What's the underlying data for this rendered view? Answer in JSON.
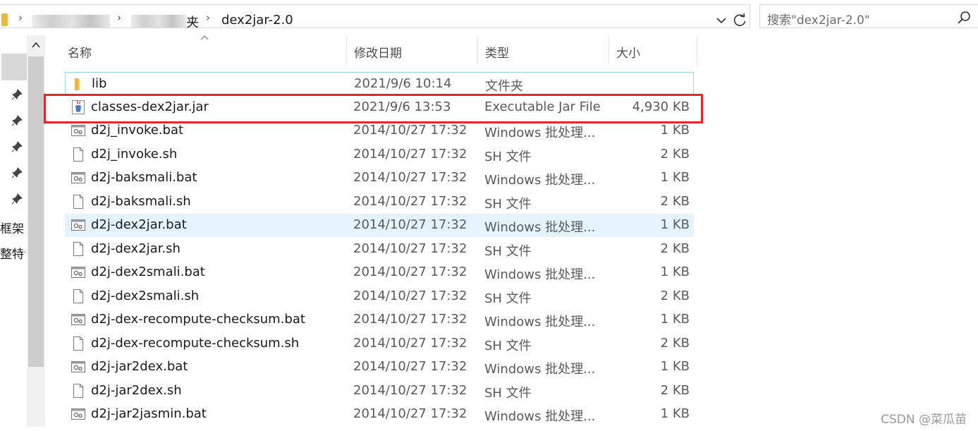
{
  "address_bar": {
    "current_folder": "dex2jar-2.0",
    "partial_crumb": "夹"
  },
  "search": {
    "placeholder": "搜索\"dex2jar-2.0\""
  },
  "nav": {
    "labels": [
      "框架",
      "整特订"
    ]
  },
  "columns": {
    "name": "名称",
    "date": "修改日期",
    "type": "类型",
    "size": "大小"
  },
  "files": [
    {
      "name": "lib",
      "date": "2021/9/6 10:14",
      "type": "文件夹",
      "size": "",
      "icon": "folder-icon"
    },
    {
      "name": "classes-dex2jar.jar",
      "date": "2021/9/6 13:53",
      "type": "Executable Jar File",
      "size": "4,930 KB",
      "icon": "jar-file-icon"
    },
    {
      "name": "d2j_invoke.bat",
      "date": "2014/10/27 17:32",
      "type": "Windows 批处理...",
      "size": "1 KB",
      "icon": "bat-file-icon"
    },
    {
      "name": "d2j_invoke.sh",
      "date": "2014/10/27 17:32",
      "type": "SH 文件",
      "size": "2 KB",
      "icon": "blank-file-icon"
    },
    {
      "name": "d2j-baksmali.bat",
      "date": "2014/10/27 17:32",
      "type": "Windows 批处理...",
      "size": "1 KB",
      "icon": "bat-file-icon"
    },
    {
      "name": "d2j-baksmali.sh",
      "date": "2014/10/27 17:32",
      "type": "SH 文件",
      "size": "2 KB",
      "icon": "blank-file-icon"
    },
    {
      "name": "d2j-dex2jar.bat",
      "date": "2014/10/27 17:32",
      "type": "Windows 批处理...",
      "size": "1 KB",
      "icon": "bat-file-icon"
    },
    {
      "name": "d2j-dex2jar.sh",
      "date": "2014/10/27 17:32",
      "type": "SH 文件",
      "size": "2 KB",
      "icon": "blank-file-icon"
    },
    {
      "name": "d2j-dex2smali.bat",
      "date": "2014/10/27 17:32",
      "type": "Windows 批处理...",
      "size": "1 KB",
      "icon": "bat-file-icon"
    },
    {
      "name": "d2j-dex2smali.sh",
      "date": "2014/10/27 17:32",
      "type": "SH 文件",
      "size": "2 KB",
      "icon": "blank-file-icon"
    },
    {
      "name": "d2j-dex-recompute-checksum.bat",
      "date": "2014/10/27 17:32",
      "type": "Windows 批处理...",
      "size": "1 KB",
      "icon": "bat-file-icon"
    },
    {
      "name": "d2j-dex-recompute-checksum.sh",
      "date": "2014/10/27 17:32",
      "type": "SH 文件",
      "size": "2 KB",
      "icon": "blank-file-icon"
    },
    {
      "name": "d2j-jar2dex.bat",
      "date": "2014/10/27 17:32",
      "type": "Windows 批处理...",
      "size": "1 KB",
      "icon": "bat-file-icon"
    },
    {
      "name": "d2j-jar2dex.sh",
      "date": "2014/10/27 17:32",
      "type": "SH 文件",
      "size": "2 KB",
      "icon": "blank-file-icon"
    },
    {
      "name": "d2j-jar2jasmin.bat",
      "date": "2014/10/27 17:32",
      "type": "Windows 批处理...",
      "size": "1 KB",
      "icon": "bat-file-icon"
    }
  ],
  "highlight": {
    "color": "#e8262d"
  },
  "watermark": "CSDN @菜瓜苗"
}
